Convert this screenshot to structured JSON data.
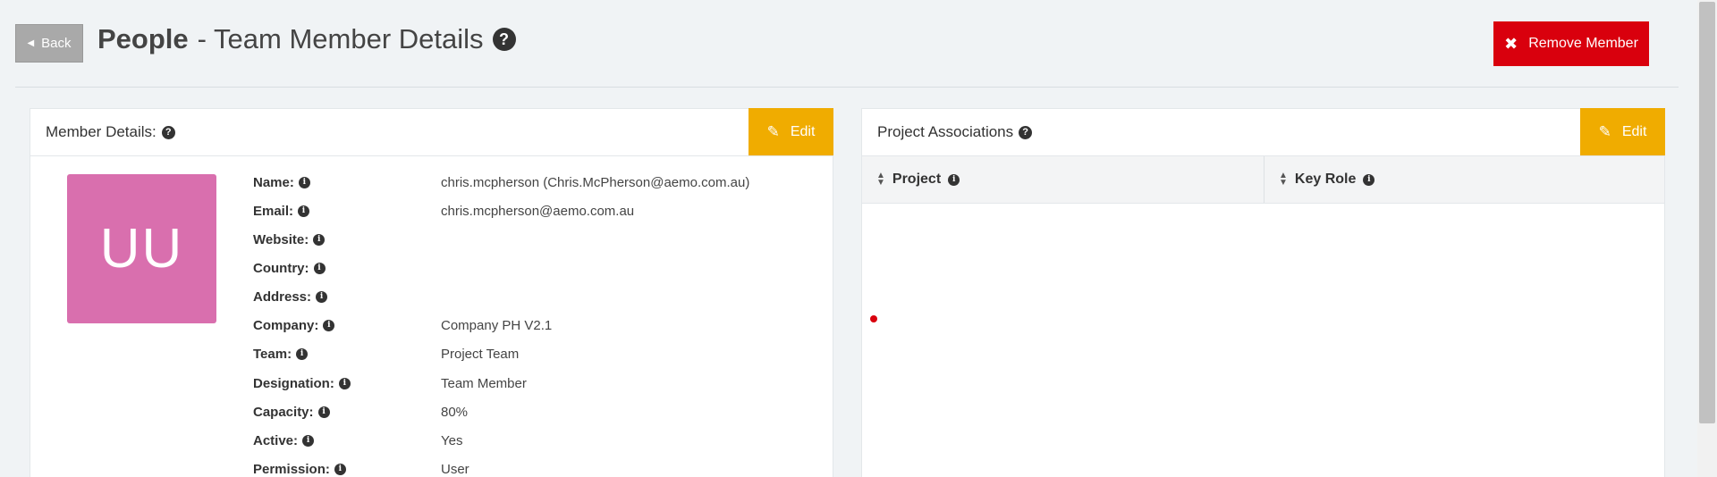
{
  "header": {
    "back_label": "Back",
    "title_strong": "People",
    "title_rest": "- Team Member Details",
    "remove_label": "Remove Member"
  },
  "member": {
    "heading": "Member Details:",
    "edit_label": "Edit",
    "avatar_initials": "UU",
    "avatar_color": "#d96fae",
    "rows": [
      {
        "label": "Name:",
        "value": "chris.mcpherson (Chris.McPherson@aemo.com.au)"
      },
      {
        "label": "Email:",
        "value": "chris.mcpherson@aemo.com.au"
      },
      {
        "label": "Website:",
        "value": ""
      },
      {
        "label": "Country:",
        "value": ""
      },
      {
        "label": "Address:",
        "value": ""
      },
      {
        "label": "Company:",
        "value": "Company PH V2.1"
      },
      {
        "label": "Team:",
        "value": "Project Team"
      },
      {
        "label": "Designation:",
        "value": "Team Member"
      },
      {
        "label": "Capacity:",
        "value": "80%"
      },
      {
        "label": "Active:",
        "value": "Yes"
      },
      {
        "label": "Permission:",
        "value": "User"
      }
    ]
  },
  "projects": {
    "heading": "Project Associations",
    "edit_label": "Edit",
    "columns": [
      "Project",
      "Key Role"
    ]
  },
  "colors": {
    "remove": "#d9000d",
    "edit": "#f0ac00",
    "back": "#a9a9a9"
  }
}
